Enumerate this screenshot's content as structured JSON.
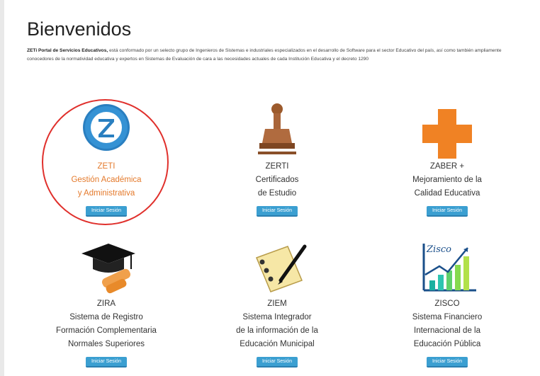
{
  "page": {
    "heading": "Bienvenidos",
    "intro_bold": "ZETi Portal de Servicios Educativos,",
    "intro_text": "está conformado por un selecto grupo de Ingenieros de Sistemas e industriales especializados en el desarrollo de Software para el sector Educativo del país, así como también ampliamente conocedores de la normatividad educativa y expertos en Sistemas de Evaluación de cara a las necesidades actuales de cada Institución Educativa y el decreto 1290"
  },
  "highlight": {
    "color": "#e0302c",
    "target": "ZETI"
  },
  "colors": {
    "accent_orange": "#e47a2c",
    "button_blue": "#3b9fd1"
  },
  "cards": [
    {
      "name": "ZETI",
      "lines": [
        "Gestión Académica",
        "y Administrativa"
      ],
      "button": "Iniciar Sesión",
      "icon": "zeti-logo-icon"
    },
    {
      "name": "ZERTI",
      "lines": [
        "Certificados",
        "de Estudio"
      ],
      "button": "Iniciar Sesión",
      "icon": "stamp-icon"
    },
    {
      "name": "ZABER +",
      "lines": [
        "Mejoramiento de la",
        "Calidad Educativa"
      ],
      "button": "Iniciar Sesión",
      "icon": "orange-cross-icon"
    },
    {
      "name": "ZIRA",
      "lines": [
        "Sistema de Registro",
        "Formación Complementaria",
        "Normales Superiores"
      ],
      "button": "Iniciar Sesión",
      "icon": "graduation-cap-icon"
    },
    {
      "name": "ZIEM",
      "lines": [
        "Sistema Integrador",
        "de la información de la",
        "Educación Municipal"
      ],
      "button": "Iniciar Sesión",
      "icon": "notepad-pen-icon"
    },
    {
      "name": "ZISCO",
      "lines": [
        "Sistema Financiero",
        "Internacional de la",
        "Educación Pública"
      ],
      "button": "Iniciar Sesión",
      "icon": "growth-chart-icon",
      "icon_text": "Zisco"
    }
  ]
}
